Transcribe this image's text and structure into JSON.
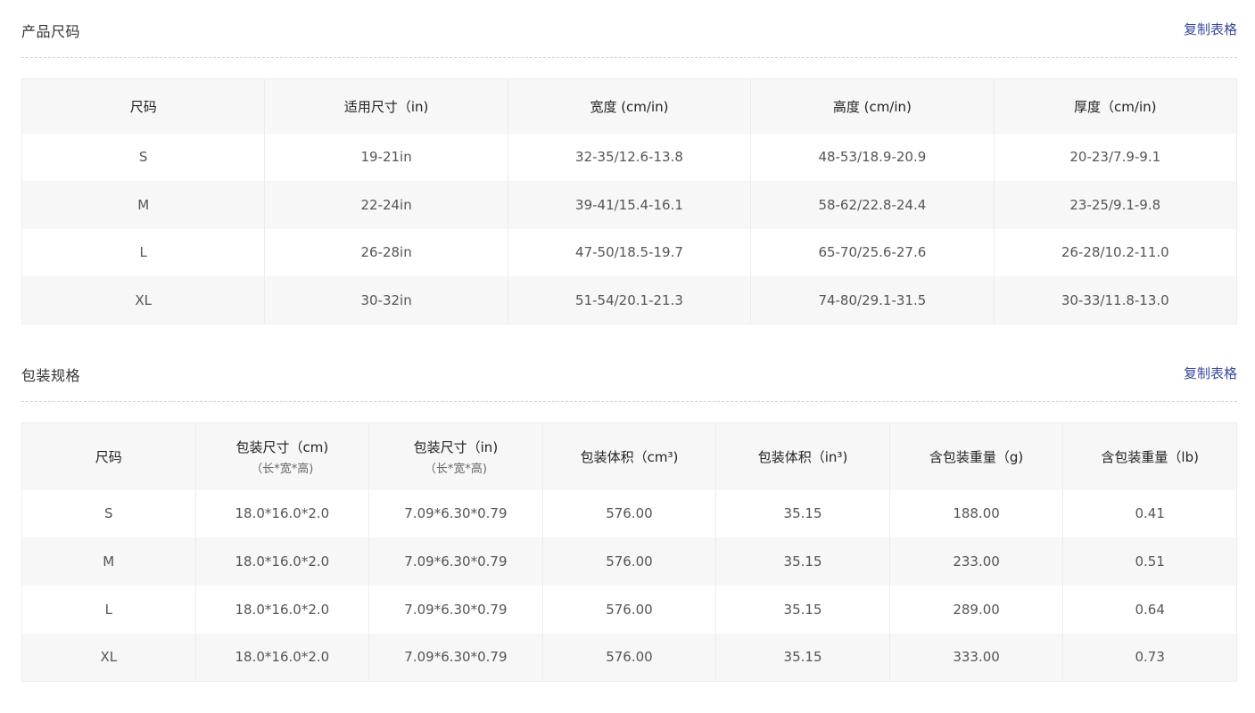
{
  "product_size": {
    "title": "产品尺码",
    "copy_label": "复制表格",
    "headers": [
      "尺码",
      "适用尺寸（in)",
      "宽度 (cm/in)",
      "高度 (cm/in)",
      "厚度（cm/in)"
    ],
    "rows": [
      [
        "S",
        "19-21in",
        "32-35/12.6-13.8",
        "48-53/18.9-20.9",
        "20-23/7.9-9.1"
      ],
      [
        "M",
        "22-24in",
        "39-41/15.4-16.1",
        "58-62/22.8-24.4",
        "23-25/9.1-9.8"
      ],
      [
        "L",
        "26-28in",
        "47-50/18.5-19.7",
        "65-70/25.6-27.6",
        "26-28/10.2-11.0"
      ],
      [
        "XL",
        "30-32in",
        "51-54/20.1-21.3",
        "74-80/29.1-31.5",
        "30-33/11.8-13.0"
      ]
    ]
  },
  "package_spec": {
    "title": "包装规格",
    "copy_label": "复制表格",
    "headers": [
      {
        "main": "尺码",
        "sub": ""
      },
      {
        "main": "包装尺寸（cm)",
        "sub": "（长*宽*高)"
      },
      {
        "main": "包装尺寸（in)",
        "sub": "（长*宽*高)"
      },
      {
        "main": "包装体积（cm³)",
        "sub": ""
      },
      {
        "main": "包装体积（in³)",
        "sub": ""
      },
      {
        "main": "含包装重量（g)",
        "sub": ""
      },
      {
        "main": "含包装重量（lb)",
        "sub": ""
      }
    ],
    "rows": [
      [
        "S",
        "18.0*16.0*2.0",
        "7.09*6.30*0.79",
        "576.00",
        "35.15",
        "188.00",
        "0.41"
      ],
      [
        "M",
        "18.0*16.0*2.0",
        "7.09*6.30*0.79",
        "576.00",
        "35.15",
        "233.00",
        "0.51"
      ],
      [
        "L",
        "18.0*16.0*2.0",
        "7.09*6.30*0.79",
        "576.00",
        "35.15",
        "289.00",
        "0.64"
      ],
      [
        "XL",
        "18.0*16.0*2.0",
        "7.09*6.30*0.79",
        "576.00",
        "35.15",
        "333.00",
        "0.73"
      ]
    ]
  }
}
